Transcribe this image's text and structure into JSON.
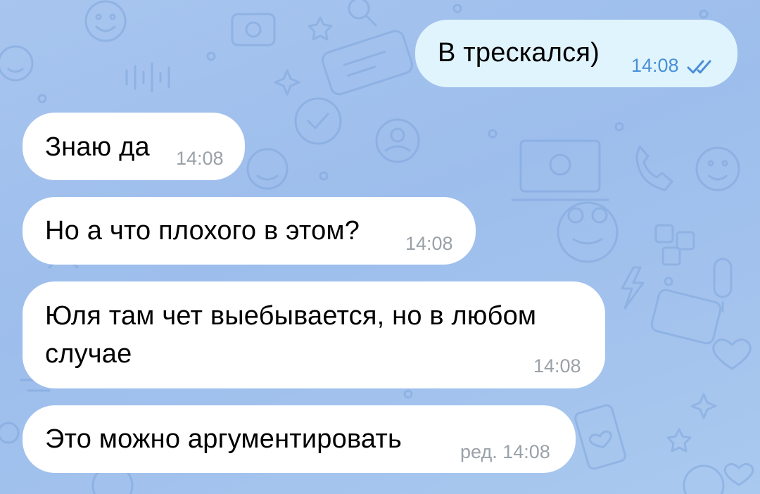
{
  "messages": [
    {
      "direction": "outgoing",
      "text": "В трескался)",
      "time": "14:08",
      "status_icon": "double-check-icon"
    },
    {
      "direction": "incoming",
      "text": "Знаю да",
      "time": "14:08"
    },
    {
      "direction": "incoming",
      "text": "Но а что плохого в этом?",
      "time": "14:08"
    },
    {
      "direction": "incoming",
      "text_line1": "Юля там чет выебывается, но в любом",
      "text_line2": "случае",
      "time": "14:08"
    },
    {
      "direction": "incoming",
      "text": "Это можно аргументировать",
      "time": "ред. 14:08"
    }
  ],
  "colors": {
    "background": "#a7c5ee",
    "incoming_bubble": "#ffffff",
    "outgoing_bubble": "#e0f4fd",
    "outgoing_meta": "#4a8fd6",
    "incoming_meta": "#9aa1a8"
  }
}
